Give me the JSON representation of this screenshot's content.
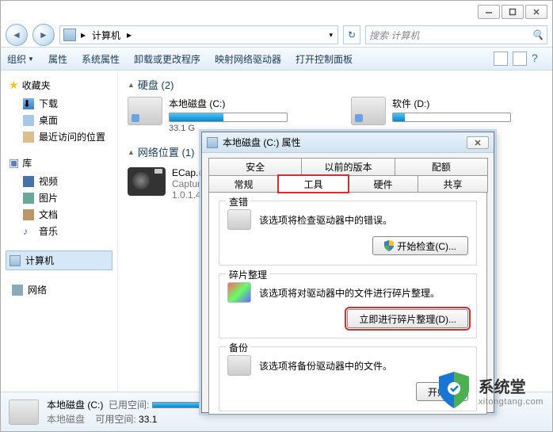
{
  "titlebar": {
    "min": "—",
    "max": "❐",
    "close": "✕"
  },
  "breadcrumb": {
    "item1": "计算机",
    "sep": "▸"
  },
  "search": {
    "placeholder": "搜索 计算机",
    "icon": "🔍"
  },
  "toolbar": {
    "organize": "组织",
    "properties": "属性",
    "sysprops": "系统属性",
    "uninstall": "卸载或更改程序",
    "mapdrive": "映射网络驱动器",
    "controlpanel": "打开控制面板"
  },
  "sidebar": {
    "fav_head": "收藏夹",
    "downloads": "下载",
    "desktop": "桌面",
    "recent": "最近访问的位置",
    "lib_head": "库",
    "videos": "视频",
    "pictures": "图片",
    "documents": "文档",
    "music": "音乐",
    "computer": "计算机",
    "network": "网络"
  },
  "content": {
    "drives_head": "硬盘 (2)",
    "drive_c_name": "本地磁盘 (C:)",
    "drive_c_text": "33.1 G",
    "drive_d_name": "软件 (D:)",
    "netloc_head": "网络位置 (1)",
    "ecap_name": "ECap.e",
    "ecap_l2": "Captur",
    "ecap_l3": "1.0.1.4"
  },
  "status": {
    "name": "本地磁盘 (C:)",
    "type": "本地磁盘",
    "used_label": "已用空间:",
    "free_label": "可用空间:",
    "free_val": "33.1"
  },
  "dialog": {
    "title": "本地磁盘 (C:) 属性",
    "tabs_top": {
      "security": "安全",
      "prev": "以前的版本",
      "quota": "配额"
    },
    "tabs_bottom": {
      "general": "常规",
      "tools": "工具",
      "hardware": "硬件",
      "sharing": "共享"
    },
    "check": {
      "title": "查错",
      "desc": "该选项将检查驱动器中的错误。",
      "btn": "开始检查(C)..."
    },
    "defrag": {
      "title": "碎片整理",
      "desc": "该选项将对驱动器中的文件进行碎片整理。",
      "btn": "立即进行碎片整理(D)..."
    },
    "backup": {
      "title": "备份",
      "desc": "该选项将备份驱动器中的文件。",
      "btn": "开始备"
    }
  },
  "watermark": {
    "brand": "系统堂",
    "url": "xitongtang.com"
  }
}
